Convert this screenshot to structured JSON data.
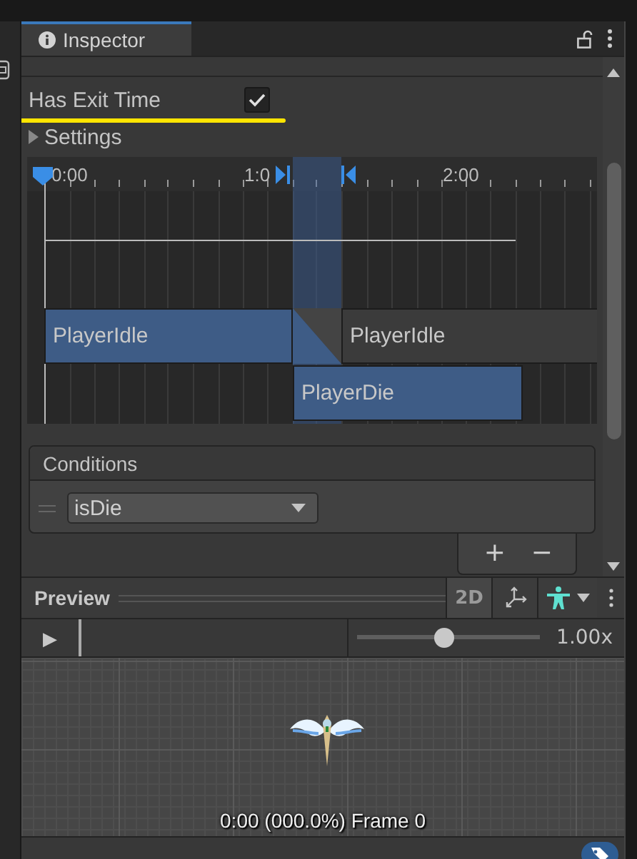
{
  "window": {
    "title": "Inspector"
  },
  "has_exit_time": {
    "label": "Has Exit Time",
    "checked": true
  },
  "settings": {
    "label": "Settings",
    "expanded": false
  },
  "timeline": {
    "ticks": [
      "0:00",
      "1:0",
      "2:00"
    ],
    "clips": [
      {
        "name": "PlayerIdle",
        "selected": true
      },
      {
        "name": "PlayerIdle",
        "selected": false
      },
      {
        "name": "PlayerDie",
        "selected": true
      }
    ]
  },
  "conditions": {
    "title": "Conditions",
    "items": [
      {
        "parameter": "isDie"
      }
    ],
    "add": "+",
    "remove": "−"
  },
  "preview": {
    "title": "Preview",
    "mode": "2D",
    "play": "▶",
    "level": 0.48,
    "speed": "1.00x",
    "status": "0:00 (000.0%) Frame 0"
  }
}
